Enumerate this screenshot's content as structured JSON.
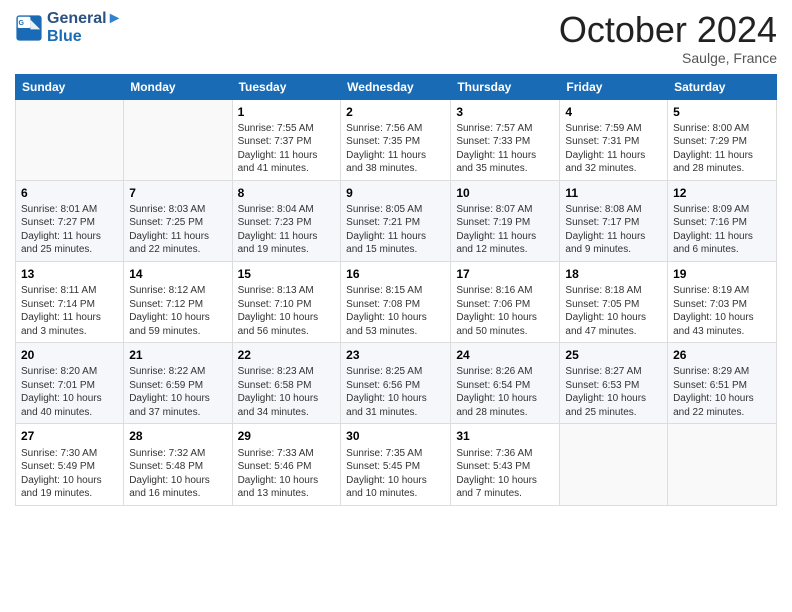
{
  "header": {
    "logo_line1": "General",
    "logo_line2": "Blue",
    "month": "October 2024",
    "location": "Saulge, France"
  },
  "weekdays": [
    "Sunday",
    "Monday",
    "Tuesday",
    "Wednesday",
    "Thursday",
    "Friday",
    "Saturday"
  ],
  "weeks": [
    [
      {
        "day": "",
        "info": ""
      },
      {
        "day": "",
        "info": ""
      },
      {
        "day": "1",
        "info": "Sunrise: 7:55 AM\nSunset: 7:37 PM\nDaylight: 11 hours and 41 minutes."
      },
      {
        "day": "2",
        "info": "Sunrise: 7:56 AM\nSunset: 7:35 PM\nDaylight: 11 hours and 38 minutes."
      },
      {
        "day": "3",
        "info": "Sunrise: 7:57 AM\nSunset: 7:33 PM\nDaylight: 11 hours and 35 minutes."
      },
      {
        "day": "4",
        "info": "Sunrise: 7:59 AM\nSunset: 7:31 PM\nDaylight: 11 hours and 32 minutes."
      },
      {
        "day": "5",
        "info": "Sunrise: 8:00 AM\nSunset: 7:29 PM\nDaylight: 11 hours and 28 minutes."
      }
    ],
    [
      {
        "day": "6",
        "info": "Sunrise: 8:01 AM\nSunset: 7:27 PM\nDaylight: 11 hours and 25 minutes."
      },
      {
        "day": "7",
        "info": "Sunrise: 8:03 AM\nSunset: 7:25 PM\nDaylight: 11 hours and 22 minutes."
      },
      {
        "day": "8",
        "info": "Sunrise: 8:04 AM\nSunset: 7:23 PM\nDaylight: 11 hours and 19 minutes."
      },
      {
        "day": "9",
        "info": "Sunrise: 8:05 AM\nSunset: 7:21 PM\nDaylight: 11 hours and 15 minutes."
      },
      {
        "day": "10",
        "info": "Sunrise: 8:07 AM\nSunset: 7:19 PM\nDaylight: 11 hours and 12 minutes."
      },
      {
        "day": "11",
        "info": "Sunrise: 8:08 AM\nSunset: 7:17 PM\nDaylight: 11 hours and 9 minutes."
      },
      {
        "day": "12",
        "info": "Sunrise: 8:09 AM\nSunset: 7:16 PM\nDaylight: 11 hours and 6 minutes."
      }
    ],
    [
      {
        "day": "13",
        "info": "Sunrise: 8:11 AM\nSunset: 7:14 PM\nDaylight: 11 hours and 3 minutes."
      },
      {
        "day": "14",
        "info": "Sunrise: 8:12 AM\nSunset: 7:12 PM\nDaylight: 10 hours and 59 minutes."
      },
      {
        "day": "15",
        "info": "Sunrise: 8:13 AM\nSunset: 7:10 PM\nDaylight: 10 hours and 56 minutes."
      },
      {
        "day": "16",
        "info": "Sunrise: 8:15 AM\nSunset: 7:08 PM\nDaylight: 10 hours and 53 minutes."
      },
      {
        "day": "17",
        "info": "Sunrise: 8:16 AM\nSunset: 7:06 PM\nDaylight: 10 hours and 50 minutes."
      },
      {
        "day": "18",
        "info": "Sunrise: 8:18 AM\nSunset: 7:05 PM\nDaylight: 10 hours and 47 minutes."
      },
      {
        "day": "19",
        "info": "Sunrise: 8:19 AM\nSunset: 7:03 PM\nDaylight: 10 hours and 43 minutes."
      }
    ],
    [
      {
        "day": "20",
        "info": "Sunrise: 8:20 AM\nSunset: 7:01 PM\nDaylight: 10 hours and 40 minutes."
      },
      {
        "day": "21",
        "info": "Sunrise: 8:22 AM\nSunset: 6:59 PM\nDaylight: 10 hours and 37 minutes."
      },
      {
        "day": "22",
        "info": "Sunrise: 8:23 AM\nSunset: 6:58 PM\nDaylight: 10 hours and 34 minutes."
      },
      {
        "day": "23",
        "info": "Sunrise: 8:25 AM\nSunset: 6:56 PM\nDaylight: 10 hours and 31 minutes."
      },
      {
        "day": "24",
        "info": "Sunrise: 8:26 AM\nSunset: 6:54 PM\nDaylight: 10 hours and 28 minutes."
      },
      {
        "day": "25",
        "info": "Sunrise: 8:27 AM\nSunset: 6:53 PM\nDaylight: 10 hours and 25 minutes."
      },
      {
        "day": "26",
        "info": "Sunrise: 8:29 AM\nSunset: 6:51 PM\nDaylight: 10 hours and 22 minutes."
      }
    ],
    [
      {
        "day": "27",
        "info": "Sunrise: 7:30 AM\nSunset: 5:49 PM\nDaylight: 10 hours and 19 minutes."
      },
      {
        "day": "28",
        "info": "Sunrise: 7:32 AM\nSunset: 5:48 PM\nDaylight: 10 hours and 16 minutes."
      },
      {
        "day": "29",
        "info": "Sunrise: 7:33 AM\nSunset: 5:46 PM\nDaylight: 10 hours and 13 minutes."
      },
      {
        "day": "30",
        "info": "Sunrise: 7:35 AM\nSunset: 5:45 PM\nDaylight: 10 hours and 10 minutes."
      },
      {
        "day": "31",
        "info": "Sunrise: 7:36 AM\nSunset: 5:43 PM\nDaylight: 10 hours and 7 minutes."
      },
      {
        "day": "",
        "info": ""
      },
      {
        "day": "",
        "info": ""
      }
    ]
  ]
}
